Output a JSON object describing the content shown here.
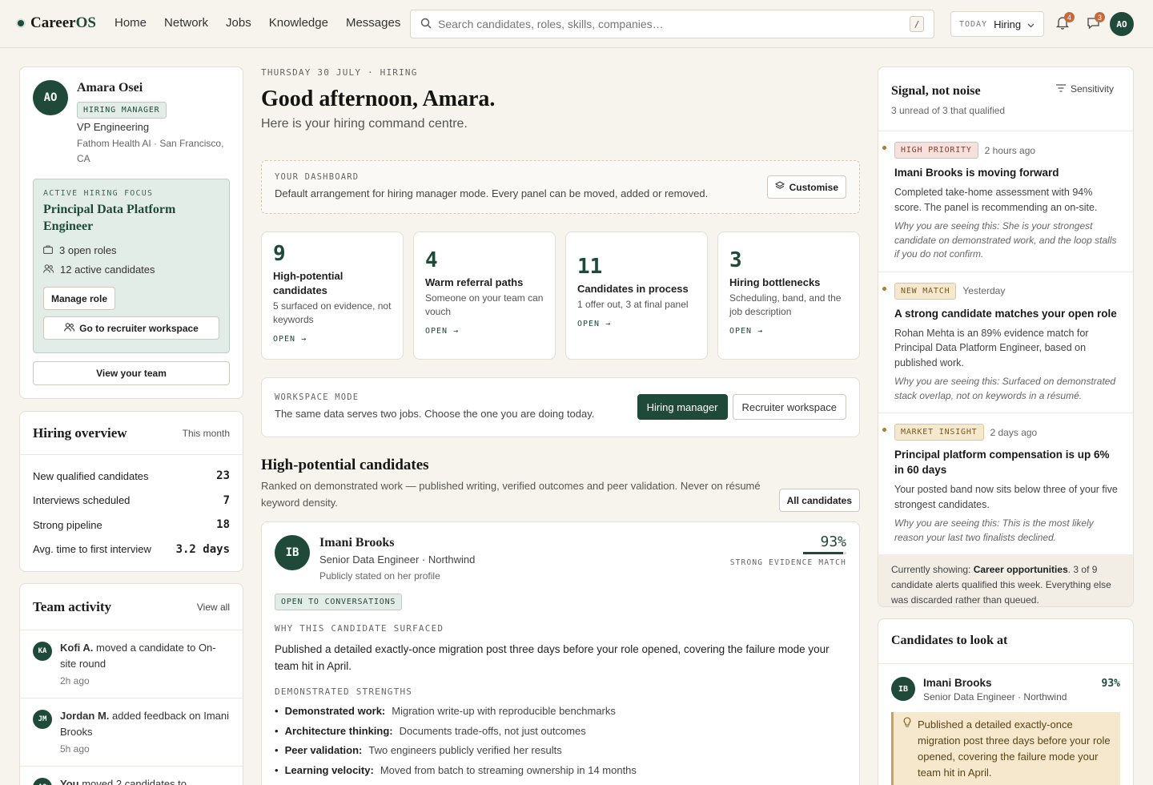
{
  "app": {
    "logo_career": "Career",
    "logo_os": "OS"
  },
  "nav": [
    "Home",
    "Network",
    "Jobs",
    "Knowledge",
    "Messages"
  ],
  "search": {
    "placeholder": "Search candidates, roles, skills, companies…",
    "shortcut": "/"
  },
  "mode": {
    "label": "TODAY",
    "value": "Hiring"
  },
  "notifications": {
    "bell_count": "4",
    "messages_count": "3"
  },
  "user": {
    "initials": "AO"
  },
  "profile": {
    "initials": "AO",
    "name": "Amara Osei",
    "role_tag": "HIRING MANAGER",
    "title": "VP Engineering",
    "company": "Fathom Health AI · San Francisco, CA",
    "focus_label": "ACTIVE HIRING FOCUS",
    "focus_title": "Principal Data Platform Engineer",
    "open_roles": "3 open roles",
    "active_candidates": "12 active candidates",
    "manage_role": "Manage role",
    "recruiter_workspace": "Go to recruiter workspace",
    "view_team": "View your team"
  },
  "overview": {
    "title": "Hiring overview",
    "period": "This month",
    "rows": [
      {
        "label": "New qualified candidates",
        "value": "23"
      },
      {
        "label": "Interviews scheduled",
        "value": "7"
      },
      {
        "label": "Strong pipeline",
        "value": "18"
      },
      {
        "label": "Avg. time to first interview",
        "value": "3.2 days"
      }
    ]
  },
  "activity": {
    "title": "Team activity",
    "view_all": "View all",
    "items": [
      {
        "initials": "KA",
        "actor": "Kofi A.",
        "text": "moved a candidate to On-site round",
        "time": "2h ago"
      },
      {
        "initials": "JM",
        "actor": "Jordan M.",
        "text": "added feedback on Imani Brooks",
        "time": "5h ago"
      },
      {
        "initials": "AO",
        "actor": "You",
        "text": "moved 2 candidates to",
        "time": ""
      }
    ]
  },
  "header": {
    "date": "THURSDAY 30 JULY · HIRING",
    "greeting": "Good afternoon, Amara.",
    "subtitle": "Here is your hiring command centre."
  },
  "dashboard": {
    "label": "YOUR DASHBOARD",
    "text": "Default arrangement for hiring manager mode. Every panel can be moved, added or removed.",
    "customise": "Customise"
  },
  "metrics": [
    {
      "number": "9",
      "title": "High-potential candidates",
      "sub": "5 surfaced on evidence, not keywords",
      "open": "OPEN"
    },
    {
      "number": "4",
      "title": "Warm referral paths",
      "sub": "Someone on your team can vouch",
      "open": "OPEN"
    },
    {
      "number": "11",
      "title": "Candidates in process",
      "sub": "1 offer out, 3 at final panel",
      "open": "OPEN"
    },
    {
      "number": "3",
      "title": "Hiring bottlenecks",
      "sub": "Scheduling, band, and the job description",
      "open": "OPEN"
    }
  ],
  "workspace": {
    "label": "WORKSPACE MODE",
    "text": "The same data serves two jobs. Choose the one you are doing today.",
    "option_1": "Hiring manager",
    "option_2": "Recruiter workspace"
  },
  "candidates_section": {
    "title": "High-potential candidates",
    "subtitle": "Ranked on demonstrated work — published writing, verified outcomes and peer validation. Never on résumé keyword density.",
    "all_button": "All candidates"
  },
  "candidate": {
    "initials": "IB",
    "name": "Imani Brooks",
    "role": "Senior Data Engineer · Northwind",
    "pronoun_note": "Publicly stated on her profile",
    "match": "93%",
    "match_fraction": 0.93,
    "match_label": "STRONG EVIDENCE MATCH",
    "status_tag": "OPEN TO CONVERSATIONS",
    "why_label": "WHY THIS CANDIDATE SURFACED",
    "why_text": "Published a detailed exactly-once migration post three days before your role opened, covering the failure mode your team hit in April.",
    "strengths_label": "DEMONSTRATED STRENGTHS",
    "strengths": [
      {
        "label": "Demonstrated work:",
        "value": "Migration write-up with reproducible benchmarks"
      },
      {
        "label": "Architecture thinking:",
        "value": "Documents trade-offs, not just outcomes"
      },
      {
        "label": "Peer validation:",
        "value": "Two engineers publicly verified her results"
      },
      {
        "label": "Learning velocity:",
        "value": "Moved from batch to streaming ownership in 14 months"
      }
    ]
  },
  "signals": {
    "title": "Signal, not noise",
    "subtitle": "3 unread of 3 that qualified",
    "sensitivity": "Sensitivity",
    "items": [
      {
        "tag": "HIGH PRIORITY",
        "time": "2 hours ago",
        "title": "Imani Brooks is moving forward",
        "body": "Completed take-home assessment with 94% score. The panel is recommending an on-site.",
        "why": "Why you are seeing this: She is your strongest candidate on demonstrated work, and the loop stalls if you do not confirm."
      },
      {
        "tag": "NEW MATCH",
        "time": "Yesterday",
        "title": "A strong candidate matches your open role",
        "body": "Rohan Mehta is an 89% evidence match for Principal Data Platform Engineer, based on published work.",
        "why": "Why you are seeing this: Surfaced on demonstrated stack overlap, not on keywords in a résumé."
      },
      {
        "tag": "MARKET INSIGHT",
        "time": "2 days ago",
        "title": "Principal platform compensation is up 6% in 60 days",
        "body": "Your posted band now sits below three of your five strongest candidates.",
        "why": "Why you are seeing this: This is the most likely reason your last two finalists declined."
      }
    ],
    "footer_prefix": "Currently showing: ",
    "footer_bold": "Career opportunities",
    "footer_suffix": ". 3 of 9 candidate alerts qualified this week. Everything else was discarded rather than queued."
  },
  "look": {
    "title": "Candidates to look at",
    "initials": "IB",
    "name": "Imani Brooks",
    "role": "Senior Data Engineer · Northwind",
    "score": "93%",
    "callout": "Published a detailed exactly-once migration post three days before your role opened, covering the failure mode your team hit in April."
  },
  "colors": {
    "brand": "#1f4a3a",
    "accent": "#c46a3a",
    "background": "#f7f4ee"
  }
}
